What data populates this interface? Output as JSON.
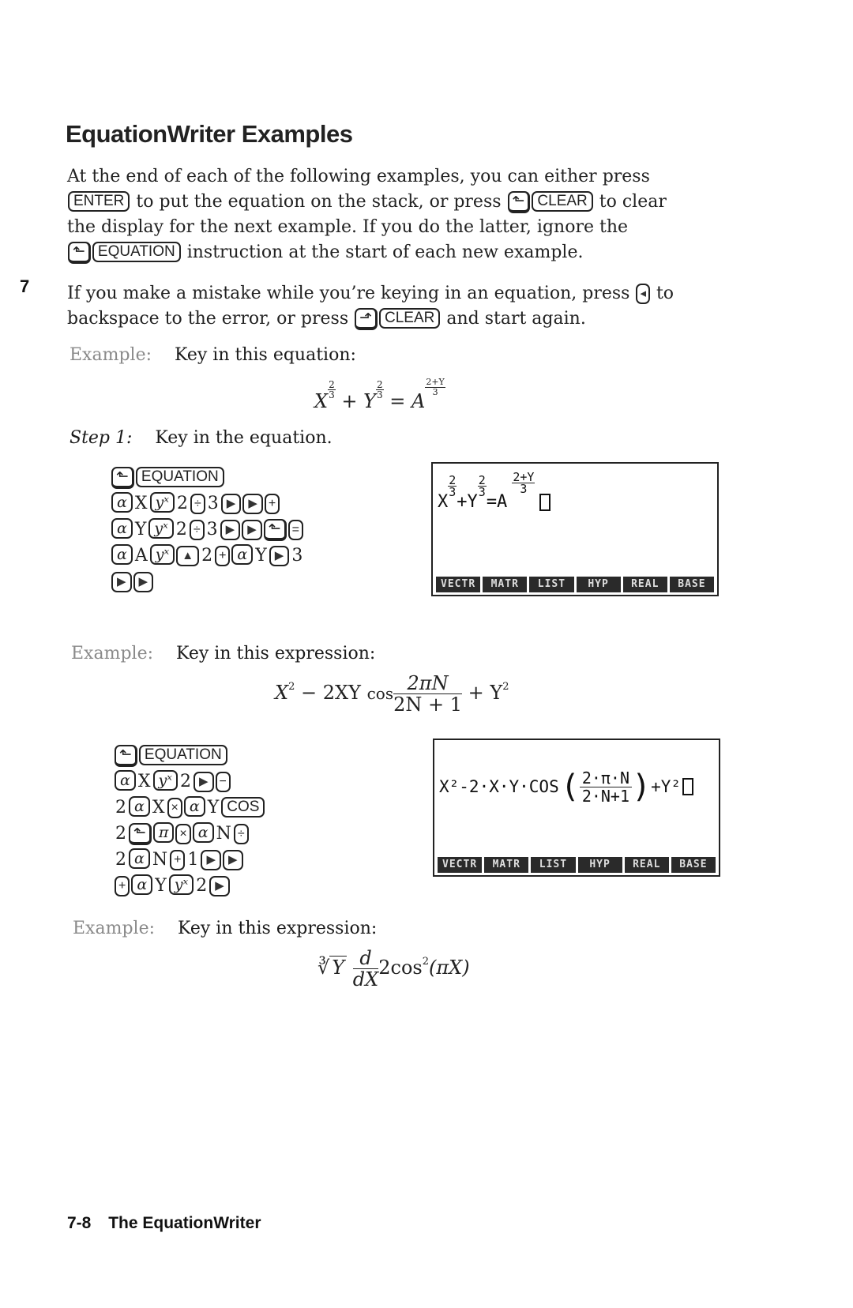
{
  "page": {
    "title": "EquationWriter Examples",
    "chapter_tab": "7",
    "intro": {
      "line1": "At the end of each of the following examples, you can either press",
      "line2_key": "ENTER",
      "line2_text": " to put the equation on the stack, or press ",
      "line2_key2": "CLEAR",
      "line2_tail": " to clear",
      "line3": "the display for the next example. If you do the latter, ignore the",
      "line4_key": "EQUATION",
      "line4_text": " instruction at the start of each new example."
    },
    "mistake": {
      "line1_text": "If you make a mistake while you’re keying in an equation, press ",
      "line1_tail": " to",
      "line2_text": "backspace to the error, or press ",
      "line2_key": "CLEAR",
      "line2_tail": " and start again."
    },
    "footer": {
      "page_number": "7-8",
      "section": "The EquationWriter"
    }
  },
  "keys": {
    "left_shift_glyph": "⬑",
    "right_shift_glyph": "⬏",
    "backspace_glyph": "◂",
    "alpha": "α",
    "power": "yˣ",
    "divide": "÷",
    "right_arrow": "▶",
    "up_arrow": "▲",
    "plus": "+",
    "minus": "−",
    "equals": "=",
    "times": "×",
    "pi": "π",
    "cos": "COS",
    "equation": "EQUATION"
  },
  "examples": [
    {
      "label": "Example:",
      "instruction": "Key in this equation:",
      "formula_text": "X^(2/3) + Y^(2/3) = A^((2+Y)/3)",
      "formula": {
        "x": "X",
        "y": "Y",
        "a": "A",
        "exp_num": "2",
        "exp_den": "3",
        "eq": "=",
        "plus": "+",
        "a_exp_num": "2+Y",
        "a_exp_den": "3"
      },
      "step_label": "Step 1:",
      "step_text": "Key in the equation.",
      "keystrokes": [
        [
          "[⬑]",
          "[EQUATION]"
        ],
        [
          "[α]",
          "X",
          "[yˣ]",
          "2",
          "[÷]",
          "3",
          "[▶]",
          "[▶]",
          "[+]"
        ],
        [
          "[α]",
          "Y",
          "[yˣ]",
          "2",
          "[÷]",
          "3",
          "[▶]",
          "[▶]",
          "[⬑]",
          "[=]"
        ],
        [
          "[α]",
          "A",
          "[yˣ]",
          "[▲]",
          "2",
          "[+]",
          "[α]",
          "Y",
          "[▶]",
          "3"
        ],
        [
          "[▶]",
          "[▶]"
        ]
      ],
      "screen": {
        "display": "X^(2/3)+Y^(2/3)=A^((2+Y)/3)",
        "menu": [
          "VECTR",
          "MATR",
          "LIST",
          "HYP",
          "REAL",
          "BASE"
        ]
      }
    },
    {
      "label": "Example:",
      "instruction": "Key in this expression:",
      "formula_text": "X^2 − 2XY cos (2πN)/(2N+1) + Y^2",
      "formula": {
        "lead": "X",
        "sq": "2",
        "mid": " − 2XY",
        "cos": "cos",
        "num": "2πN",
        "den": "2N + 1",
        "tail": " + Y"
      },
      "keystrokes": [
        [
          "[⬑]",
          "[EQUATION]"
        ],
        [
          "[α]",
          "X",
          "[yˣ]",
          "2",
          "[▶]",
          "[−]"
        ],
        [
          "2",
          "[α]",
          "X",
          "[×]",
          "[α]",
          "Y",
          "[COS]"
        ],
        [
          "2",
          "[⬑]",
          "[π]",
          "[×]",
          "[α]",
          "N",
          "[÷]"
        ],
        [
          "2",
          "[α]",
          "N",
          "[+]",
          "1",
          "[▶]",
          "[▶]"
        ],
        [
          "[+]",
          "[α]",
          "Y",
          "[yˣ]",
          "2",
          "[▶]"
        ]
      ],
      "screen": {
        "display_left": "X²-2·X·Y·COS",
        "display_num": "2·π·N",
        "display_den": "2·N+1",
        "display_right": "+Y²",
        "menu": [
          "VECTR",
          "MATR",
          "LIST",
          "HYP",
          "REAL",
          "BASE"
        ]
      }
    },
    {
      "label": "Example:",
      "instruction": "Key in this expression:",
      "formula_text": "∛(Y) d/dX 2cos²(πX)",
      "formula": {
        "root": "∛",
        "rad": "Y",
        "d_num": "d",
        "d_den": "dX",
        "body": "2cos",
        "sq": "2",
        "arg": "(πX)"
      }
    }
  ]
}
